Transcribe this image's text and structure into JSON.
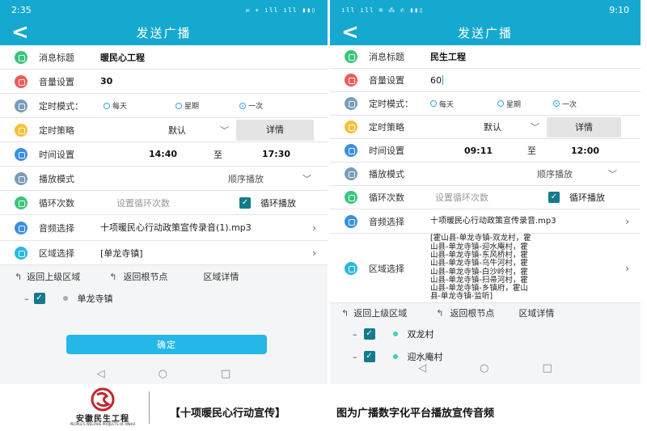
{
  "left": {
    "status": {
      "time": "2:35",
      "icons": "✉ ✈ ıll ıll ▮▮▯"
    },
    "header": {
      "back": "<",
      "title": "发送广播"
    },
    "rows": {
      "title": {
        "label": "消息标题",
        "value": "暖民心工程"
      },
      "volume": {
        "label": "音量设置",
        "value": "30"
      },
      "timing_mode": {
        "label": "定时模式：",
        "options": [
          "每天",
          "星期",
          "一次"
        ]
      },
      "strategy": {
        "label": "定时策略",
        "value": "默认",
        "chevron": "﹀",
        "detail": "详情"
      },
      "time": {
        "label": "时间设置",
        "start": "14:40",
        "to": "至",
        "end": "17:30"
      },
      "play_mode": {
        "label": "播放模式",
        "value": "顺序播放",
        "chevron": "﹀"
      },
      "loop": {
        "label": "循环次数",
        "placeholder": "设置循环次数",
        "check_label": "循环播放"
      },
      "audio": {
        "label": "音频选择",
        "value": "十项暖民心行动政策宣传录音(1).mp3",
        "arrow": "›"
      },
      "area": {
        "label": "区域选择",
        "value": "[单龙寺镇]",
        "arrow": "›"
      }
    },
    "nav": {
      "up": "返回上级区域",
      "root": "返回根节点",
      "detail": "区域详情"
    },
    "tree": [
      {
        "name": "单龙寺镇"
      }
    ],
    "confirm": "确定",
    "sysnav": [
      "◁",
      "○",
      "□"
    ]
  },
  "right": {
    "status": {
      "time": "9:10",
      "icons": "ıll ıll ≋ ⁂ ✆ ▮▮▯"
    },
    "header": {
      "back": "<",
      "title": "发送广播"
    },
    "rows": {
      "title": {
        "label": "消息标题",
        "value": "民生工程"
      },
      "volume": {
        "label": "音量设置",
        "value": "60"
      },
      "timing_mode": {
        "label": "定时模式：",
        "options": [
          "每天",
          "星期",
          "一次"
        ]
      },
      "strategy": {
        "label": "定时策略",
        "value": "默认",
        "chevron": "﹀",
        "detail": "详情"
      },
      "time": {
        "label": "时间设置",
        "start": "09:11",
        "to": "至",
        "end": "12:00"
      },
      "play_mode": {
        "label": "播放模式",
        "value": "顺序播放",
        "chevron": "﹀"
      },
      "loop": {
        "label": "循环次数",
        "placeholder": "设置循环次数",
        "check_label": "循环播放"
      },
      "audio": {
        "label": "音频选择",
        "value": "十项暖民心行动政策宣传录音.mp3",
        "arrow": "›"
      },
      "area": {
        "label": "区域选择",
        "lines": [
          "[霍山县-单龙寺镇-双龙村，霍",
          "山县-单龙寺镇-迎水庵村，霍",
          "山县-单龙寺镇-东风桥村，霍",
          "山县-单龙寺镇-乌牛河村，霍",
          "山县-单龙寺镇-白沙岭村，霍",
          "山县-单龙寺镇-扫帚河村，霍",
          "山县-单龙寺镇-乡镇府，霍山",
          "县-单龙寺镇-监听]"
        ],
        "arrow": "›"
      }
    },
    "nav": {
      "up": "返回上级区域",
      "root": "返回根节点",
      "detail": "区域详情"
    },
    "tree": [
      {
        "name": "双龙村"
      },
      {
        "name": "迎水庵村"
      }
    ],
    "sysnav": [
      "◁",
      "○",
      "□"
    ]
  },
  "footer": {
    "logo_text": "安徽民生工程",
    "logo_subtext": "PEOPLE'S WELFARE PROJECTS OF ANHUI",
    "caption_bracket": "【十项暖民心行动宣传】",
    "caption_text": "图为广播数字化平台播放宣传音频"
  },
  "colors": {
    "header": "#15a9cf",
    "confirm": "#25b7e8",
    "check": "#157a8c",
    "logo_red": "#c0272d",
    "icons": [
      "#3cc47c",
      "#ef5b5b",
      "#7a9db8",
      "#f5c038",
      "#3b8fe0",
      "#7a9db8",
      "#3cc47c",
      "#3b8fe0",
      "#29b8e0"
    ]
  }
}
